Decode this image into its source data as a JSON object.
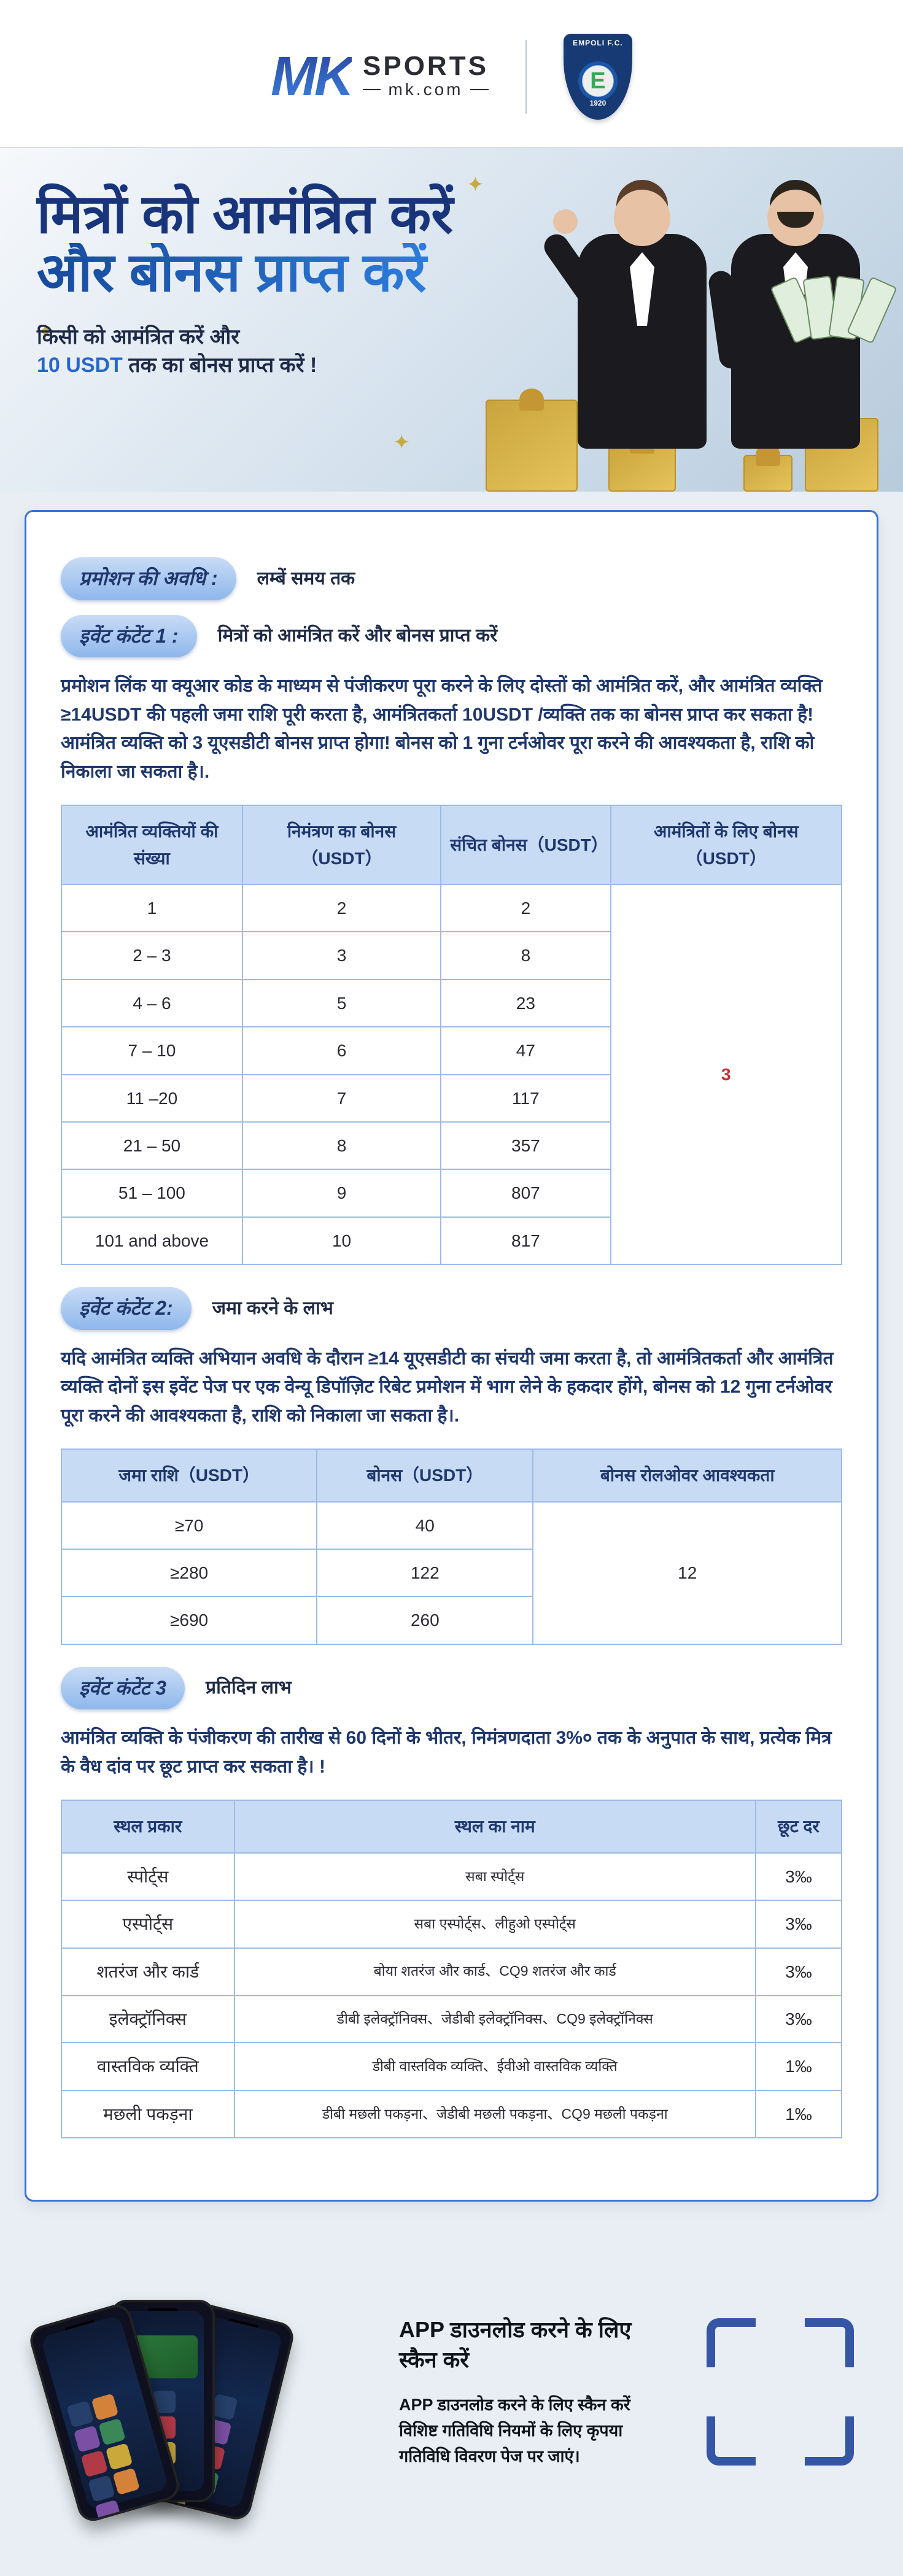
{
  "header": {
    "logo_mk": "MK",
    "logo_sports": "SPORTS",
    "logo_sub": "mk.com",
    "badge_top": "EMPOLI F.C.",
    "badge_center": "E",
    "badge_year": "1920"
  },
  "hero": {
    "title_line1": "मित्रों को आमंत्रित करें",
    "title_line2": "और बोनस प्राप्त करें",
    "sub_line1": "किसी को आमंत्रित करें और",
    "sub_highlight": "10 USDT",
    "sub_line2_rest": " तक का बोनस प्राप्त करें !"
  },
  "promo": {
    "period_label": "प्रमोशन की अवधि :",
    "period_value": "लम्बें समय तक",
    "ev1_label": "इवेंट कंटेंट 1 :",
    "ev1_title": "मित्रों को आमंत्रित करें और बोनस प्राप्त करें",
    "ev1_body": "प्रमोशन लिंक या क्यूआर कोड के माध्यम से पंजीकरण पूरा करने के लिए दोस्तों को आमंत्रित करें, और आमंत्रित व्यक्ति ≥14USDT की पहली जमा राशि पूरी करता है, आमंत्रितकर्ता 10USDT /व्यक्ति तक का बोनस प्राप्त कर सकता है! आमंत्रित व्यक्ति को 3 यूएसडीटी बोनस प्राप्त होगा! बोनस को 1 गुना टर्नओवर पूरा करने की आवश्यकता है, राशि को निकाला जा सकता है।.",
    "t1_head": [
      "आमंत्रित व्यक्तियों की संख्या",
      "निमंत्रण का बोनस（USDT）",
      "संचित बोनस（USDT）",
      "आमंत्रितों के लिए बोनस（USDT）"
    ],
    "t1_rows": [
      [
        "1",
        "2",
        "2"
      ],
      [
        "2 – 3",
        "3",
        "8"
      ],
      [
        "4 – 6",
        "5",
        "23"
      ],
      [
        "7 – 10",
        "6",
        "47"
      ],
      [
        "11 –20",
        "7",
        "117"
      ],
      [
        "21 – 50",
        "8",
        "357"
      ],
      [
        "51 – 100",
        "9",
        "807"
      ],
      [
        "101 and above",
        "10",
        "817"
      ]
    ],
    "t1_merge": "3",
    "ev2_label": "इवेंट कंटेंट 2:",
    "ev2_title": "जमा करने के लाभ",
    "ev2_body": "यदि आमंत्रित व्यक्ति अभियान अवधि के दौरान ≥14 यूएसडीटी का संचयी जमा करता है, तो आमंत्रितकर्ता और आमंत्रित व्यक्ति दोनों इस इवेंट पेज पर एक वेन्यू डिपॉज़िट रिबेट प्रमोशन में भाग लेने के हकदार होंगे, बोनस को 12 गुना टर्नओवर पूरा करने की आवश्यकता है, राशि को निकाला जा सकता है।.",
    "t2_head": [
      "जमा राशि（USDT）",
      "बोनस（USDT）",
      "बोनस रोलओवर आवश्यकता"
    ],
    "t2_rows": [
      [
        "≥70",
        "40"
      ],
      [
        "≥280",
        "122"
      ],
      [
        "≥690",
        "260"
      ]
    ],
    "t2_merge": "12",
    "ev3_label": "इवेंट कंटेंट 3",
    "ev3_title": "प्रतिदिन लाभ",
    "ev3_body": "आमंत्रित व्यक्ति के पंजीकरण की तारीख से 60 दिनों के भीतर, निमंत्रणदाता 3%० तक के अनुपात के साथ, प्रत्येक मित्र के वैध दांव पर छूट प्राप्त कर सकता है। !",
    "t3_head": [
      "स्थल प्रकार",
      "स्थल का नाम",
      "छूट दर"
    ],
    "t3_rows": [
      [
        "स्पोर्ट्स",
        "सबा स्पोर्ट्स",
        "3‰"
      ],
      [
        "एस्पोर्ट्स",
        "सबा एस्पोर्ट्स、लीहुओ एस्पोर्ट्स",
        "3‰"
      ],
      [
        "शतरंज और कार्ड",
        "बोया शतरंज और कार्ड、CQ9 शतरंज और कार्ड",
        "3‰"
      ],
      [
        "इलेक्ट्रॉनिक्स",
        "डीबी इलेक्ट्रॉनिक्स、जेडीबी इलेक्ट्रॉनिक्स、CQ9 इलेक्ट्रॉनिक्स",
        "3‰"
      ],
      [
        "वास्तविक व्यक्ति",
        "डीबी वास्तविक व्यक्ति、ईवीओ वास्तविक व्यक्ति",
        "1‰"
      ],
      [
        "मछली पकड़ना",
        "डीबी मछली पकड़ना、जेडीबी मछली पकड़ना、CQ9 मछली पकड़ना",
        "1‰"
      ]
    ]
  },
  "footer": {
    "heading": "APP  डाउनलोड करने के लिए स्कैन करें",
    "body": "APP  डाउनलोड करने के लिए स्कैन करें\nविशिष्ट गतिविधि नियमों के लिए कृपया गतिविधि विवरण पेज पर जाएं।"
  }
}
